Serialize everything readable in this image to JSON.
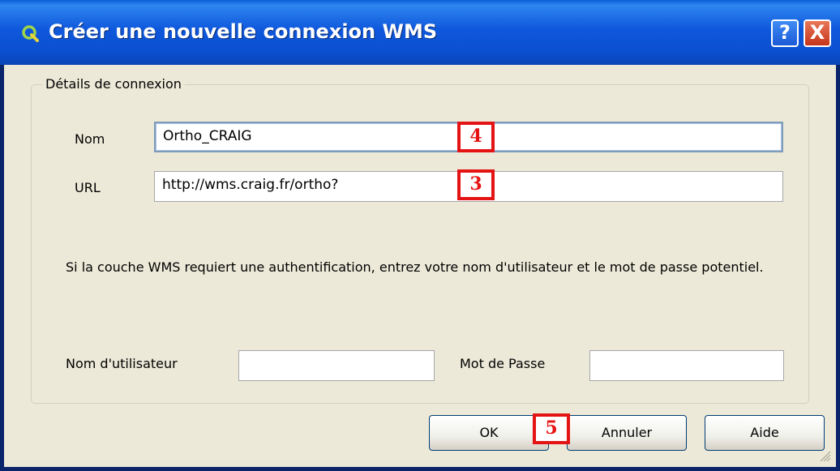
{
  "window": {
    "title": "Créer une nouvelle connexion WMS",
    "help_glyph": "?",
    "close_glyph": "X",
    "icon": "qgis-icon"
  },
  "group": {
    "title": "Détails de connexion"
  },
  "name": {
    "label": "Nom",
    "value": "Ortho_CRAIG"
  },
  "url": {
    "label": "URL",
    "value": "http://wms.craig.fr/ortho?"
  },
  "auth": {
    "info": "Si la couche WMS requiert une authentification, entrez votre nom d'utilisateur et le mot de passe potentiel.",
    "username_label": "Nom d'utilisateur",
    "username_value": "",
    "password_label": "Mot de Passe",
    "password_value": ""
  },
  "buttons": {
    "ok": "OK",
    "cancel": "Annuler",
    "help": "Aide"
  },
  "annotations": {
    "badge_name": "4",
    "badge_url": "3",
    "badge_ok": "5",
    "color": "#e51414"
  }
}
